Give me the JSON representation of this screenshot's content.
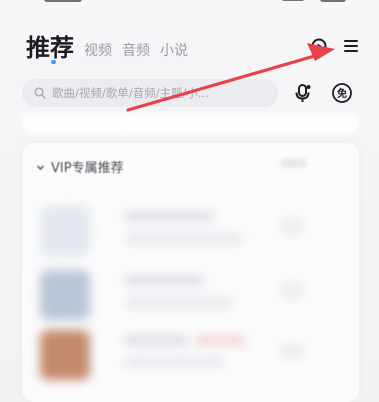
{
  "header": {
    "tabs": [
      {
        "label": "推荐",
        "active": true
      },
      {
        "label": "视频",
        "active": false
      },
      {
        "label": "音频",
        "active": false
      },
      {
        "label": "小说",
        "active": false
      }
    ],
    "icons": [
      "play-circle-icon",
      "menu-icon"
    ]
  },
  "search": {
    "placeholder": "歌曲/视频/歌单/音频/主题/小..."
  },
  "side_icons": [
    "mic-icon",
    "free-badge-icon"
  ],
  "free_badge": "免",
  "vip_section": {
    "title": "VIP专属推荐"
  },
  "annotation": {
    "type": "arrow",
    "color": "#e8414a",
    "points_to": "menu-icon"
  },
  "colors": {
    "accent": "#3aa0ff",
    "arrow": "#e8414a",
    "background": "#f3f3f5"
  }
}
